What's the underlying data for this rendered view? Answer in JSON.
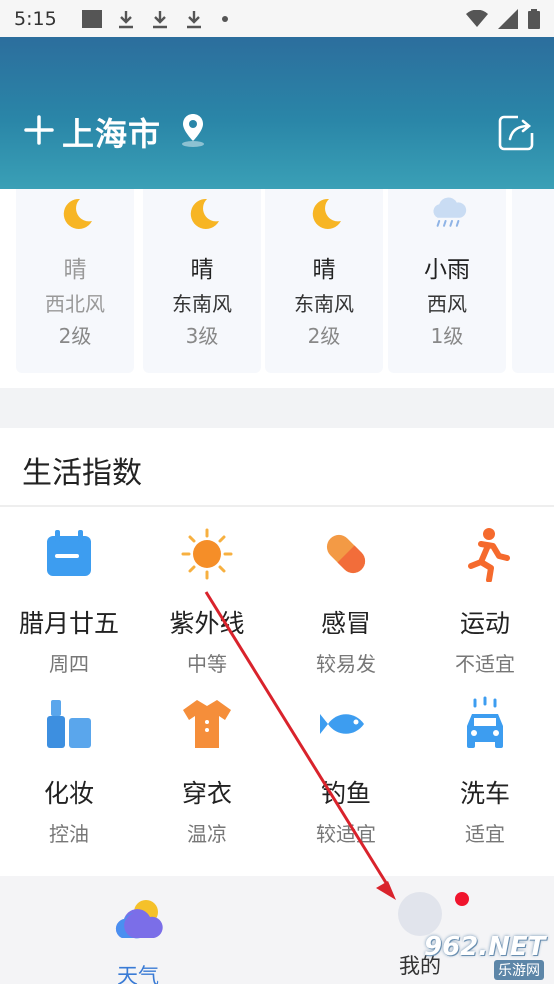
{
  "status_bar": {
    "time": "5:15"
  },
  "header": {
    "city": "上海市",
    "icons": [
      "add-icon",
      "location-pin-icon",
      "share-icon"
    ],
    "gradient_colors": [
      "#2c6e9d",
      "#3aa0b6"
    ]
  },
  "forecast": [
    {
      "icon": "moon-icon",
      "condition": "晴",
      "wind": "西北风",
      "level": "2级",
      "dim": true
    },
    {
      "icon": "moon-icon",
      "condition": "晴",
      "wind": "东南风",
      "level": "3级",
      "dim": false
    },
    {
      "icon": "moon-icon",
      "condition": "晴",
      "wind": "东南风",
      "level": "2级",
      "dim": false
    },
    {
      "icon": "rain-cloud-icon",
      "condition": "小雨",
      "wind": "西风",
      "level": "1级",
      "dim": false
    }
  ],
  "life_index": {
    "title": "生活指数",
    "items": [
      {
        "icon": "calendar-icon",
        "name": "腊月廿五",
        "value": "周四"
      },
      {
        "icon": "sun-icon",
        "name": "紫外线",
        "value": "中等"
      },
      {
        "icon": "capsule-icon",
        "name": "感冒",
        "value": "较易发"
      },
      {
        "icon": "running-icon",
        "name": "运动",
        "value": "不适宜"
      },
      {
        "icon": "cosmetics-icon",
        "name": "化妆",
        "value": "控油"
      },
      {
        "icon": "shirt-icon",
        "name": "穿衣",
        "value": "温凉"
      },
      {
        "icon": "fish-icon",
        "name": "钓鱼",
        "value": "较适宜"
      },
      {
        "icon": "car-wash-icon",
        "name": "洗车",
        "value": "适宜"
      }
    ]
  },
  "bottom_nav": {
    "weather_label": "天气",
    "mine_label": "我的",
    "active_color": "#3a7bd5",
    "badge_color": "#f0142d"
  },
  "watermark": {
    "number": "962.NET",
    "subtitle": "乐游网"
  }
}
